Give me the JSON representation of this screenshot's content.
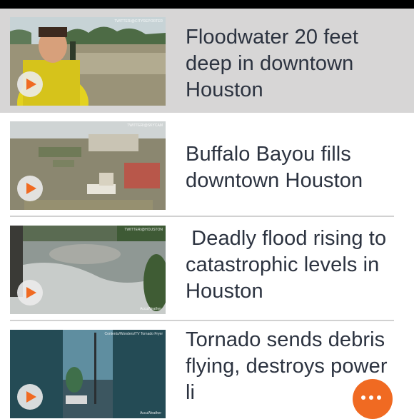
{
  "feed": {
    "items": [
      {
        "headline": "Floodwater 20 feet deep in downtown Houston",
        "thumbnail_watermark": "TWITTER/@CITYREPORTER",
        "selected": true
      },
      {
        "headline": "Buffalo Bayou fills downtown Houston",
        "thumbnail_watermark": "TWITTER/@SKYCAM",
        "selected": false
      },
      {
        "headline": " Deadly flood rising to catastrophic levels in Houston",
        "thumbnail_watermark": "AccuWeather",
        "thumbnail_watermark_top": "TWITTER/@HOUSTON",
        "selected": false
      },
      {
        "headline": "Tornado sends debris flying, destroys power li",
        "thumbnail_watermark": "AccuWeather",
        "thumbnail_watermark_top": "Contents/Wonders/TV Tornado Fryer",
        "selected": false
      }
    ]
  },
  "icons": {
    "play": "play-icon",
    "more": "more-options-icon"
  },
  "colors": {
    "accent": "#f06a22",
    "headline_text": "#2c3340",
    "selected_row": "#d7d6d6",
    "divider": "#d1d1d1"
  }
}
